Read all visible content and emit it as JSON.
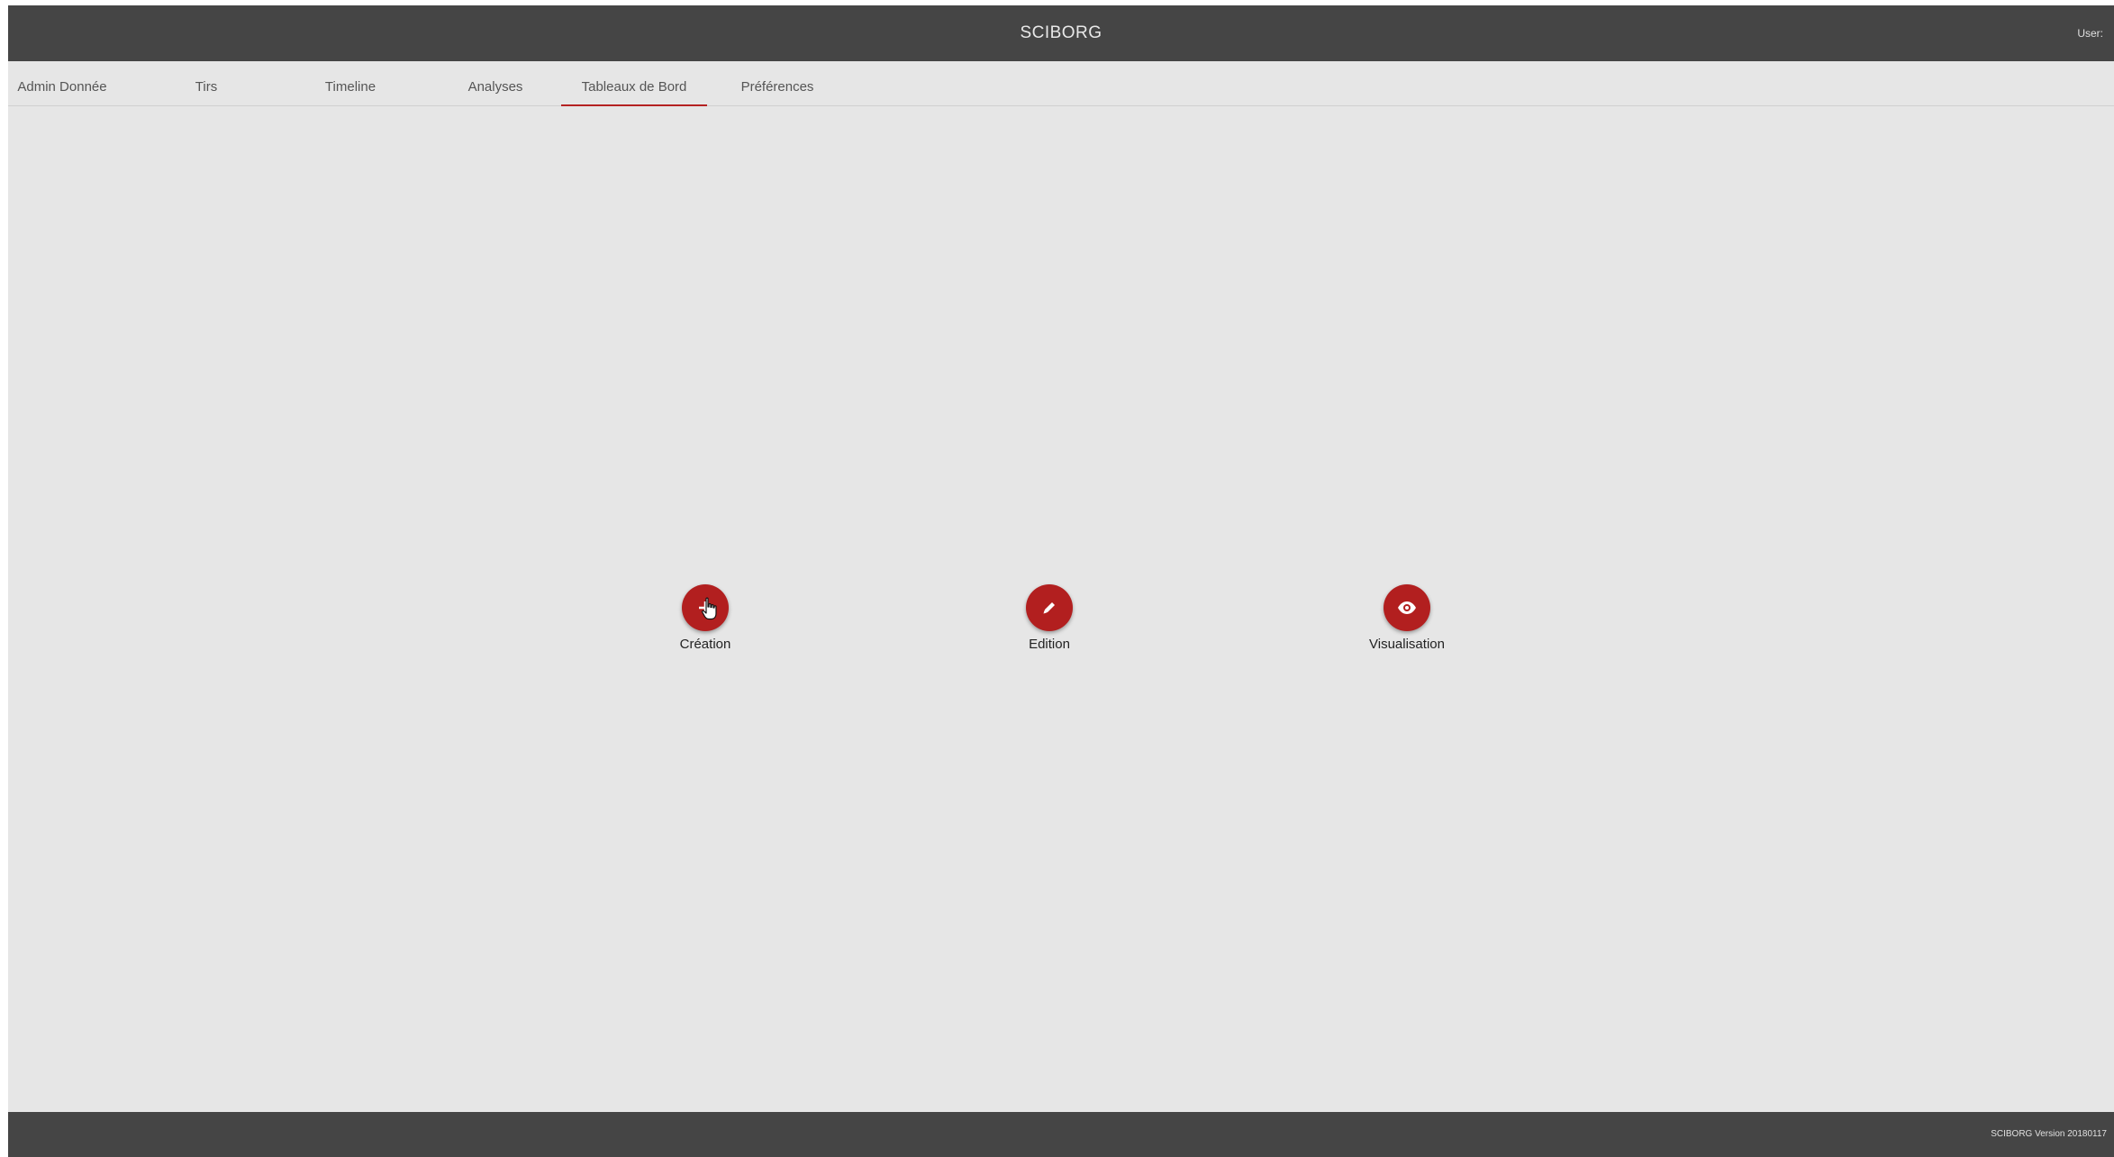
{
  "header": {
    "title": "SCIBORG",
    "user_label": "User:"
  },
  "tabs": [
    {
      "label": "Admin Donnée",
      "active": false
    },
    {
      "label": "Tirs",
      "active": false
    },
    {
      "label": "Timeline",
      "active": false
    },
    {
      "label": "Analyses",
      "active": false
    },
    {
      "label": "Tableaux de Bord",
      "active": true
    },
    {
      "label": "Préférences",
      "active": false
    }
  ],
  "actions": [
    {
      "label": "Création",
      "icon": "plus-icon"
    },
    {
      "label": "Edition",
      "icon": "pencil-icon"
    },
    {
      "label": "Visualisation",
      "icon": "eye-icon"
    }
  ],
  "footer": {
    "version_text": "SCIBORG Version 20180117"
  },
  "colors": {
    "header_bg": "#454545",
    "content_bg": "#e6e6e6",
    "accent": "#b21f1f"
  }
}
